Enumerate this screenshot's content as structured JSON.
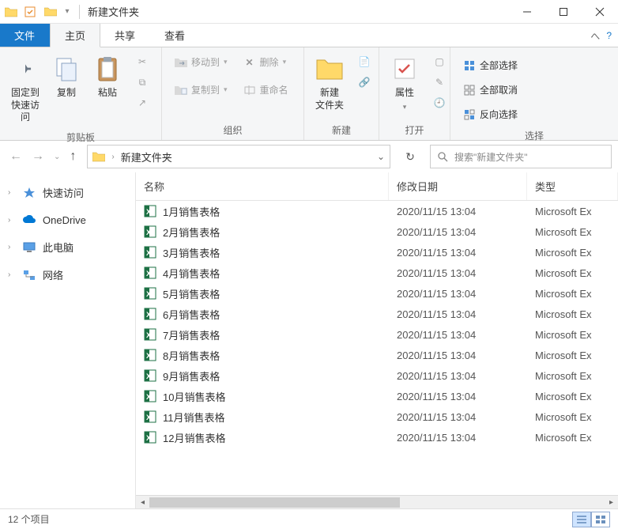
{
  "titlebar": {
    "title": "新建文件夹"
  },
  "tabs": {
    "file": "文件",
    "home": "主页",
    "share": "共享",
    "view": "查看"
  },
  "ribbon": {
    "clipboard": {
      "label": "剪贴板",
      "pin": "固定到\n快速访问",
      "copy": "复制",
      "paste": "粘贴"
    },
    "organize": {
      "label": "组织",
      "moveTo": "移动到",
      "copyTo": "复制到",
      "delete": "删除",
      "rename": "重命名"
    },
    "new": {
      "label": "新建",
      "newFolder": "新建\n文件夹"
    },
    "open": {
      "label": "打开",
      "properties": "属性"
    },
    "select": {
      "label": "选择",
      "selectAll": "全部选择",
      "selectNone": "全部取消",
      "invert": "反向选择"
    }
  },
  "nav": {
    "path": "新建文件夹",
    "searchPlaceholder": "搜索\"新建文件夹\""
  },
  "sidebar": {
    "quickAccess": "快速访问",
    "oneDrive": "OneDrive",
    "thisPC": "此电脑",
    "network": "网络"
  },
  "columns": {
    "name": "名称",
    "date": "修改日期",
    "type": "类型"
  },
  "files": [
    {
      "name": "1月销售表格",
      "date": "2020/11/15 13:04",
      "type": "Microsoft Ex"
    },
    {
      "name": "2月销售表格",
      "date": "2020/11/15 13:04",
      "type": "Microsoft Ex"
    },
    {
      "name": "3月销售表格",
      "date": "2020/11/15 13:04",
      "type": "Microsoft Ex"
    },
    {
      "name": "4月销售表格",
      "date": "2020/11/15 13:04",
      "type": "Microsoft Ex"
    },
    {
      "name": "5月销售表格",
      "date": "2020/11/15 13:04",
      "type": "Microsoft Ex"
    },
    {
      "name": "6月销售表格",
      "date": "2020/11/15 13:04",
      "type": "Microsoft Ex"
    },
    {
      "name": "7月销售表格",
      "date": "2020/11/15 13:04",
      "type": "Microsoft Ex"
    },
    {
      "name": "8月销售表格",
      "date": "2020/11/15 13:04",
      "type": "Microsoft Ex"
    },
    {
      "name": "9月销售表格",
      "date": "2020/11/15 13:04",
      "type": "Microsoft Ex"
    },
    {
      "name": "10月销售表格",
      "date": "2020/11/15 13:04",
      "type": "Microsoft Ex"
    },
    {
      "name": "11月销售表格",
      "date": "2020/11/15 13:04",
      "type": "Microsoft Ex"
    },
    {
      "name": "12月销售表格",
      "date": "2020/11/15 13:04",
      "type": "Microsoft Ex"
    }
  ],
  "status": {
    "count": "12 个项目"
  }
}
